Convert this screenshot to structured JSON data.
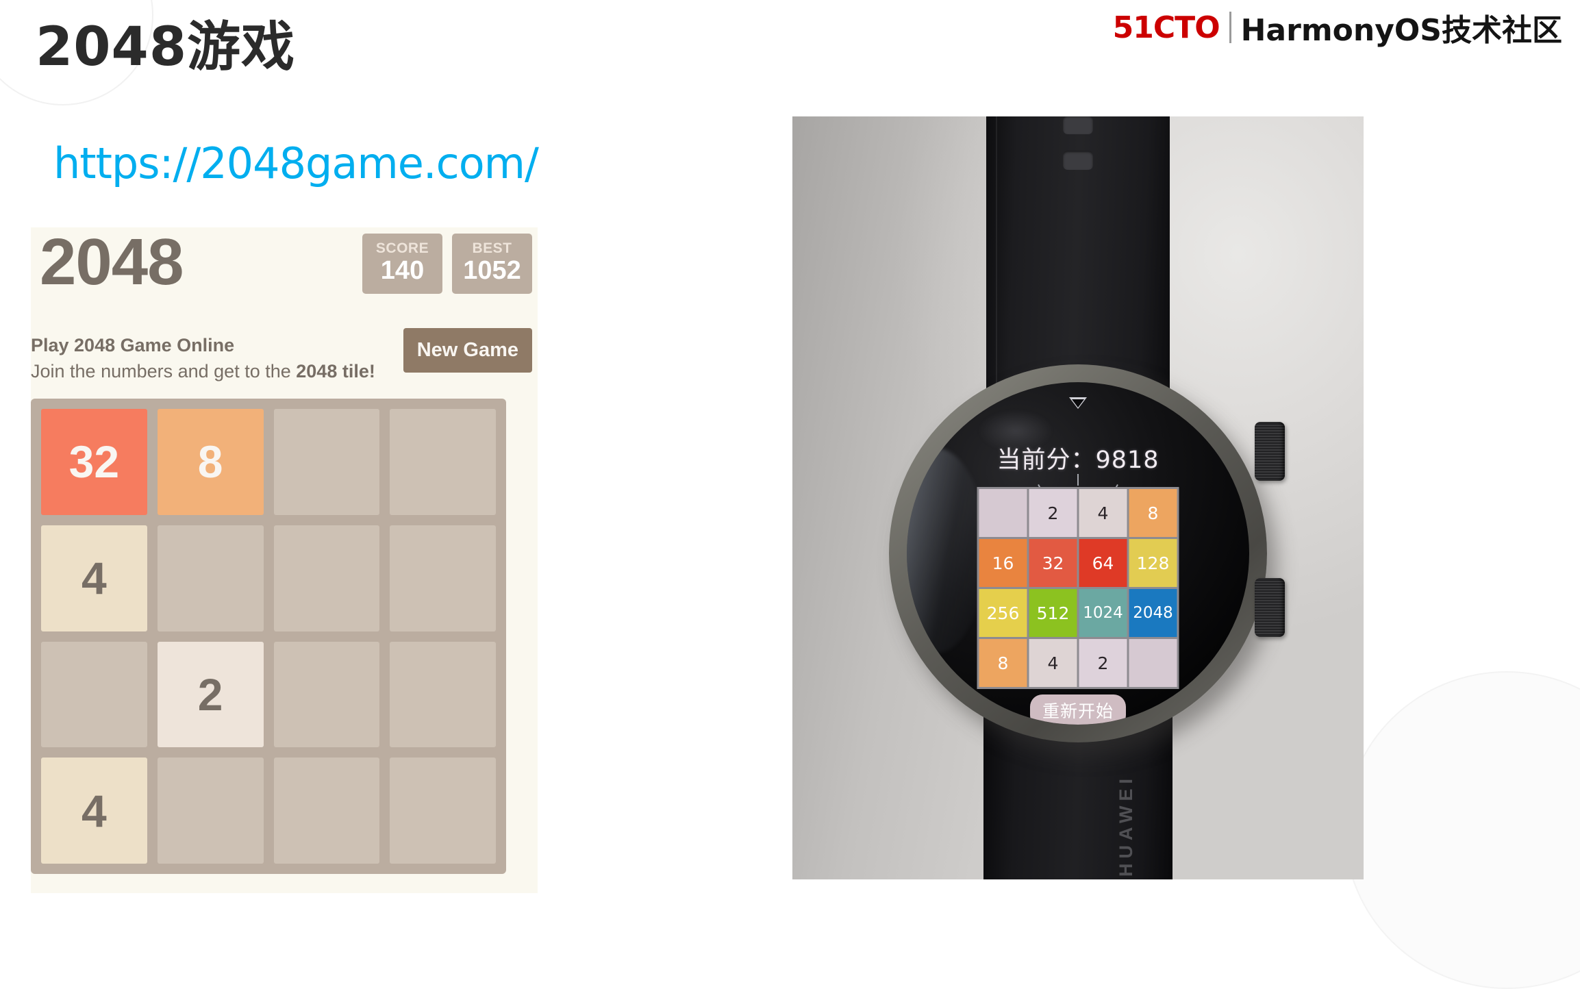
{
  "slide": {
    "title": "2048游戏",
    "url": "https://2048game.com/"
  },
  "brand": {
    "logo_text": "51CTO",
    "name": "HarmonyOS技术社区"
  },
  "web_game": {
    "heading": "2048",
    "score_label": "SCORE",
    "score_value": "140",
    "best_label": "BEST",
    "best_value": "1052",
    "tagline_primary": "Play 2048 Game Online",
    "tagline_secondary_plain": "Join the numbers and get to the ",
    "tagline_secondary_bold": "2048 tile!",
    "new_game_label": "New Game",
    "colors": {
      "panel_bg": "#faf8ef",
      "grid_bg": "#bbada0",
      "empty_cell": "#cdc1b4",
      "text": "#776e65",
      "button": "#8f7a66"
    },
    "board": [
      [
        "32",
        "8",
        "",
        ""
      ],
      [
        "4",
        "",
        "",
        ""
      ],
      [
        "",
        "2",
        "",
        ""
      ],
      [
        "4",
        "",
        "",
        ""
      ]
    ]
  },
  "watch": {
    "score_text": "当前分：9818",
    "score_label": "当前分",
    "score_value": "9818",
    "restart_label": "重新开始",
    "strap_brand": "HUAWEI",
    "board": [
      [
        "",
        "2",
        "4",
        "8"
      ],
      [
        "16",
        "32",
        "64",
        "128"
      ],
      [
        "256",
        "512",
        "1024",
        "2048"
      ],
      [
        "8",
        "4",
        "2",
        ""
      ]
    ],
    "colors": {
      "tile_2": "#ded2db",
      "tile_4": "#ded4d4",
      "tile_8": "#eda560",
      "tile_16": "#e9843f",
      "tile_32": "#e25a42",
      "tile_64": "#df3a26",
      "tile_128": "#e2cc52",
      "tile_256": "#e5cf4c",
      "tile_512": "#8cc220",
      "tile_1024": "#6ba8a2",
      "tile_2048": "#1a79c0",
      "tile_empty": "#d6c9d2",
      "restart_bg": "#cfbcc2"
    }
  }
}
